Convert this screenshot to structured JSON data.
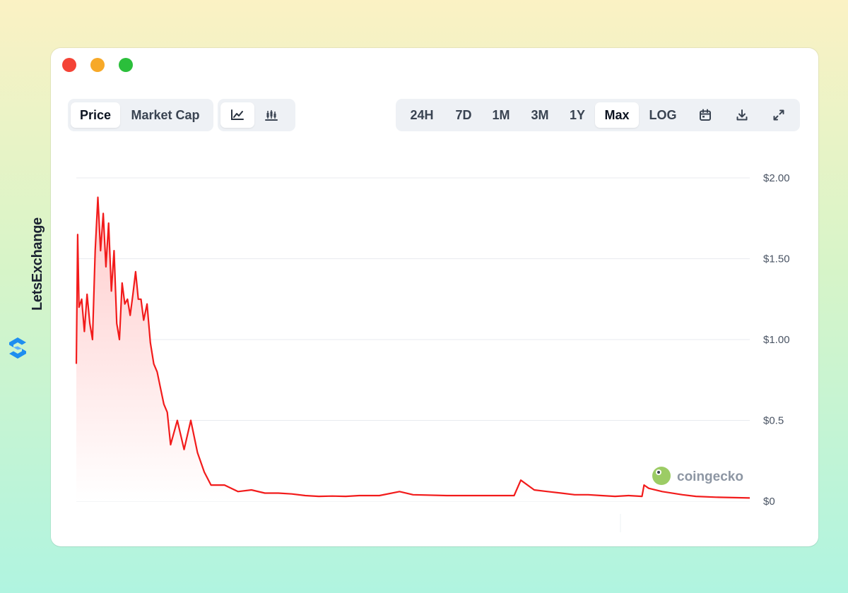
{
  "brand": {
    "name": "LetsExchange"
  },
  "toolbar": {
    "metric_tabs": [
      {
        "label": "Price",
        "active": true
      },
      {
        "label": "Market Cap",
        "active": false
      }
    ],
    "chart_types": [
      {
        "icon": "line-chart-icon",
        "active": true
      },
      {
        "icon": "candlestick-chart-icon",
        "active": false
      }
    ],
    "ranges": [
      {
        "label": "24H",
        "active": false
      },
      {
        "label": "7D",
        "active": false
      },
      {
        "label": "1M",
        "active": false
      },
      {
        "label": "3M",
        "active": false
      },
      {
        "label": "1Y",
        "active": false
      },
      {
        "label": "Max",
        "active": true
      },
      {
        "label": "LOG",
        "active": false
      }
    ],
    "actions": [
      "calendar-icon",
      "download-icon",
      "expand-icon"
    ]
  },
  "watermark": {
    "text": "coingecko"
  },
  "colors": {
    "line": "#f21b1b",
    "fill_top": "#ffc9c9",
    "fill_bottom": "#ffffff",
    "grid": "#e8ebef"
  },
  "chart_data": {
    "type": "area",
    "title": "",
    "xlabel": "",
    "ylabel": "",
    "ylim": [
      0,
      2.0
    ],
    "ytick_labels": [
      "$2.00",
      "$1.50",
      "$1.00",
      "$0.5",
      "$0"
    ],
    "ytick_values": [
      2.0,
      1.5,
      1.0,
      0.5,
      0
    ],
    "grid": true,
    "series": [
      {
        "x": [
          0,
          0.2,
          0.4,
          0.8,
          1.2,
          1.6,
          2.0,
          2.4,
          2.8,
          3.2,
          3.6,
          4.0,
          4.4,
          4.8,
          5.2,
          5.6,
          6.0,
          6.4,
          6.8,
          7.2,
          7.6,
          8.0,
          8.4,
          8.8,
          9.2,
          9.6,
          10,
          10.5,
          11,
          11.5,
          12,
          12.5,
          13,
          13.5,
          14,
          15,
          16,
          17,
          18,
          19,
          20,
          22,
          24,
          26,
          28,
          30,
          32,
          34,
          36,
          38,
          40,
          42,
          45,
          48,
          50,
          55,
          60,
          65,
          66,
          68,
          70,
          72,
          74,
          76,
          78,
          80,
          82,
          84,
          84.3,
          85,
          87,
          90,
          92,
          95,
          100
        ],
        "values": [
          0.85,
          1.65,
          1.2,
          1.25,
          1.05,
          1.28,
          1.1,
          1.0,
          1.55,
          1.88,
          1.55,
          1.78,
          1.45,
          1.72,
          1.3,
          1.55,
          1.1,
          1.0,
          1.35,
          1.22,
          1.25,
          1.15,
          1.28,
          1.42,
          1.25,
          1.25,
          1.12,
          1.22,
          0.98,
          0.85,
          0.8,
          0.7,
          0.6,
          0.55,
          0.35,
          0.5,
          0.32,
          0.5,
          0.3,
          0.18,
          0.1,
          0.1,
          0.06,
          0.07,
          0.05,
          0.05,
          0.045,
          0.035,
          0.03,
          0.032,
          0.03,
          0.035,
          0.035,
          0.06,
          0.04,
          0.035,
          0.035,
          0.035,
          0.13,
          0.07,
          0.06,
          0.05,
          0.04,
          0.04,
          0.035,
          0.03,
          0.035,
          0.03,
          0.1,
          0.08,
          0.06,
          0.04,
          0.03,
          0.025,
          0.02
        ]
      }
    ]
  }
}
